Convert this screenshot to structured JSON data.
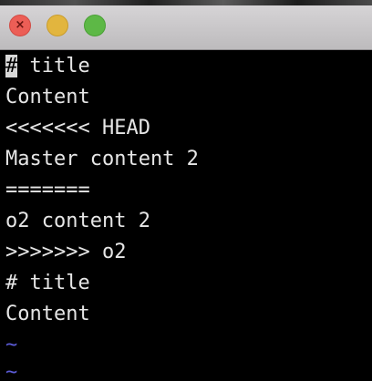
{
  "window": {
    "controls": {
      "close_icon": "close-icon",
      "close_glyph": "×",
      "minimize_icon": "minimize-icon",
      "zoom_icon": "zoom-icon"
    }
  },
  "colors": {
    "background": "#000000",
    "text": "#e6e6e6",
    "tilde": "#5b5bd6",
    "close": "#ec5e56",
    "minimize": "#e2b53e",
    "zoom": "#5db846"
  },
  "editor": {
    "cursor_char": "#",
    "line_1_rest": " title",
    "lines": [
      "Content",
      "<<<<<<< HEAD",
      "Master content 2",
      "=======",
      "o2 content 2",
      ">>>>>>> o2",
      "# title",
      "Content"
    ],
    "tildes": [
      "~",
      "~"
    ]
  }
}
